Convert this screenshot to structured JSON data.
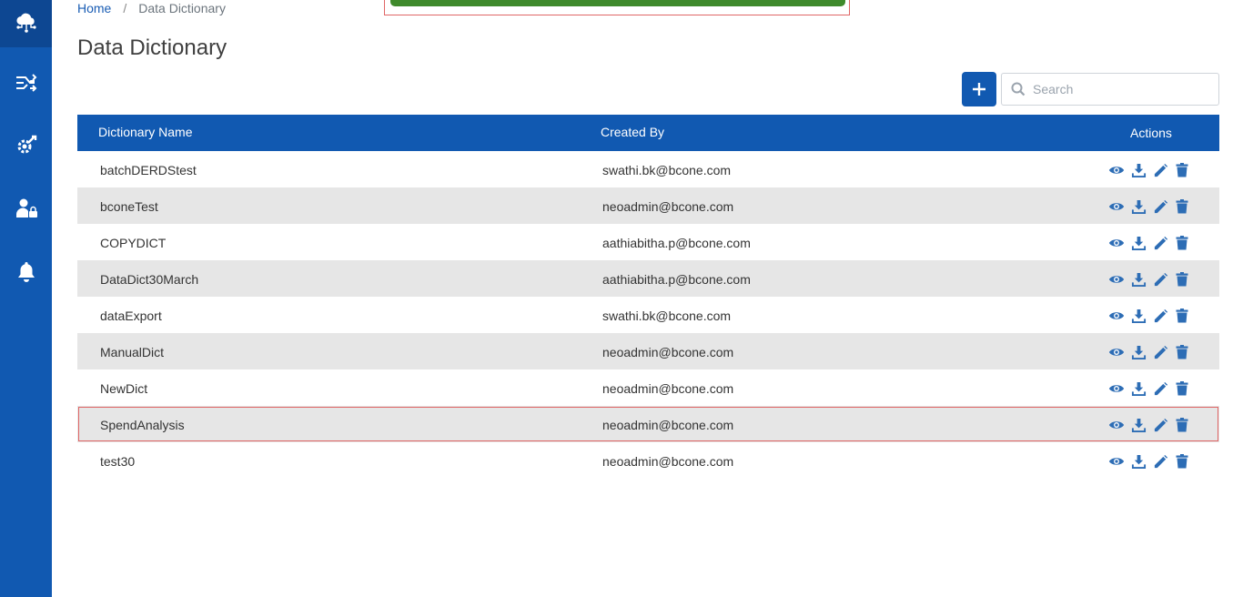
{
  "breadcrumb": {
    "home": "Home",
    "separator": "/",
    "current": "Data Dictionary"
  },
  "page": {
    "title": "Data Dictionary"
  },
  "toolbar": {
    "add_icon": "plus-icon",
    "search_placeholder": "Search",
    "search_value": ""
  },
  "sidebar": {
    "items": [
      {
        "icon": "cloud-network-icon",
        "active": true
      },
      {
        "icon": "shuffle-flow-icon",
        "active": false
      },
      {
        "icon": "gear-wrench-icon",
        "active": false
      },
      {
        "icon": "user-lock-icon",
        "active": false
      },
      {
        "icon": "bell-icon",
        "active": false
      }
    ]
  },
  "table": {
    "headers": {
      "name": "Dictionary Name",
      "created_by": "Created By",
      "actions": "Actions"
    },
    "rows": [
      {
        "name": "batchDERDStest",
        "created_by": "swathi.bk@bcone.com"
      },
      {
        "name": "bconeTest",
        "created_by": "neoadmin@bcone.com"
      },
      {
        "name": "COPYDICT",
        "created_by": "aathiabitha.p@bcone.com"
      },
      {
        "name": "DataDict30March",
        "created_by": "aathiabitha.p@bcone.com"
      },
      {
        "name": "dataExport",
        "created_by": "swathi.bk@bcone.com"
      },
      {
        "name": "ManualDict",
        "created_by": "neoadmin@bcone.com"
      },
      {
        "name": "NewDict",
        "created_by": "neoadmin@bcone.com"
      },
      {
        "name": "SpendAnalysis",
        "created_by": "neoadmin@bcone.com"
      },
      {
        "name": "test30",
        "created_by": "neoadmin@bcone.com"
      }
    ],
    "action_icons": [
      "eye-icon",
      "download-icon",
      "pencil-icon",
      "trash-icon"
    ]
  },
  "colors": {
    "primary": "#1159b1",
    "row_alt": "#e6e6e6",
    "toast": "#3f8a2c",
    "highlight": "#e06666",
    "icon": "#2d6db5"
  }
}
